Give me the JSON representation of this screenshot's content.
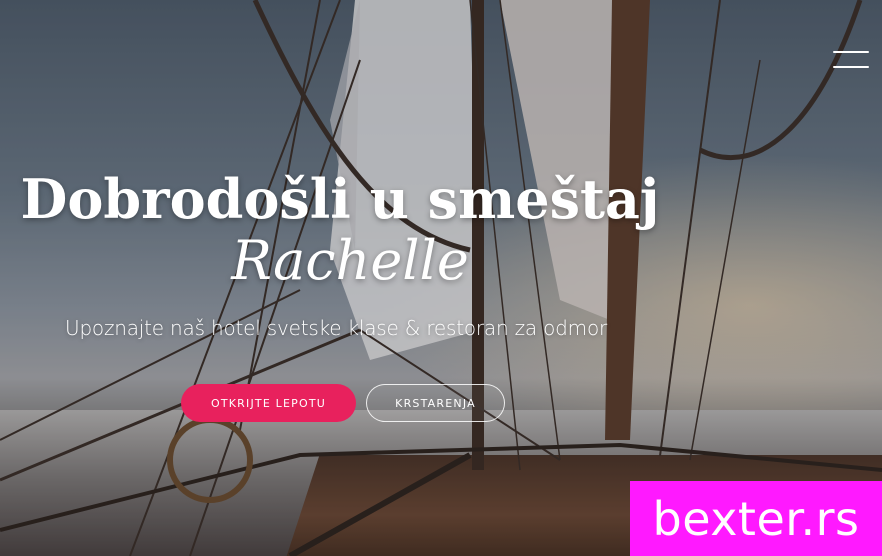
{
  "hero": {
    "title_line1": "Dobrodošli u smeštaj",
    "title_line2": "Rachelle",
    "subtitle": "Upoznajte naš hotel svetske klase & restoran za odmor",
    "primary_button": "OTKRIJTE LEPOTU",
    "secondary_button": "KRSTARENJA"
  },
  "watermark": {
    "text": "bexter.rs"
  },
  "colors": {
    "primary_button": "#e8215d",
    "watermark_bg": "#ff19ff",
    "text": "#ffffff"
  },
  "icons": {
    "menu": "hamburger-menu-icon"
  }
}
